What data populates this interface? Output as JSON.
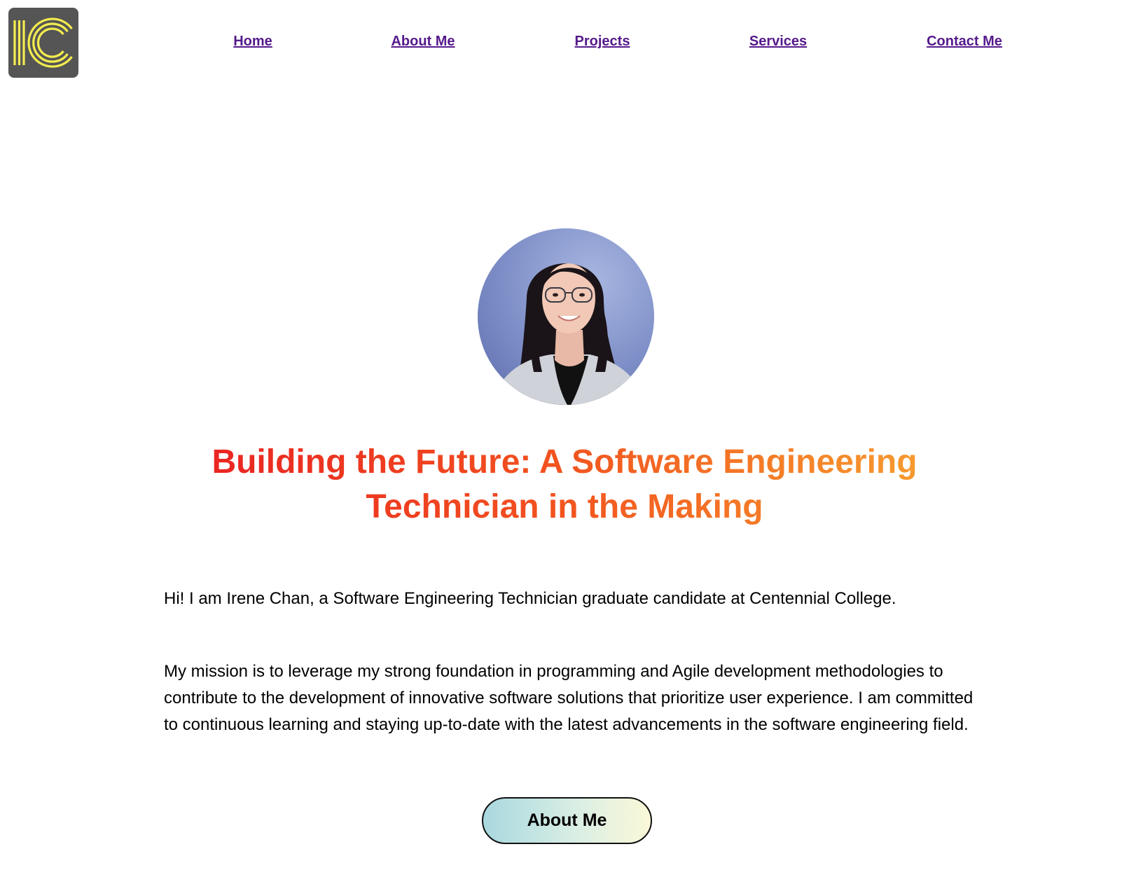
{
  "brand": {
    "logo_text": "IC",
    "logo_bg": "#555555",
    "logo_stroke": "#f3ec4e"
  },
  "nav": {
    "items": [
      {
        "label": "Home"
      },
      {
        "label": "About Me"
      },
      {
        "label": "Projects"
      },
      {
        "label": "Services"
      },
      {
        "label": "Contact Me"
      }
    ],
    "link_color": "#551a8b"
  },
  "hero": {
    "headline": "Building the Future: A Software Engineering Technician in the Making",
    "headline_gradient": [
      "#e81c22",
      "#f2541f",
      "#f7a832"
    ]
  },
  "content": {
    "intro": "Hi! I am Irene Chan, a Software Engineering Technician graduate candidate at Centennial College.",
    "mission": "My mission is to leverage my strong foundation in programming and Agile development methodologies to contribute to the development of innovative software solutions that prioritize user experience. I am committed to continuous learning and staying up-to-date with the latest advancements in the software engineering field."
  },
  "cta": {
    "label": "About Me",
    "gradient": [
      "#a9d8df",
      "#fbf8d8"
    ]
  }
}
